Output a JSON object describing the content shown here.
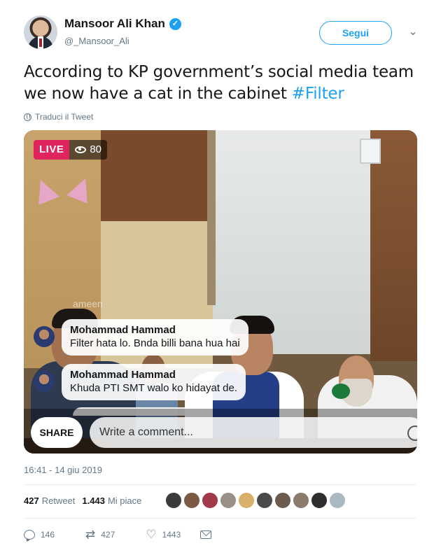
{
  "author": {
    "name": "Mansoor Ali Khan",
    "handle": "@_Mansoor_Ali",
    "verified_glyph": "✓",
    "avatar_icon": "profile-photo"
  },
  "header": {
    "follow_label": "Segui",
    "more_glyph": "⌄"
  },
  "tweet": {
    "text": "According to KP government’s social media team we now have a cat in the cabinet ",
    "hashtag": "#Filter",
    "translate_label": "Traduci il Tweet",
    "timestamp": "16:41 - 14 giu 2019"
  },
  "video": {
    "live_label": "LIVE",
    "viewer_count": "80",
    "faded_comment": "ameen",
    "comments": [
      {
        "name": "Mohammad Hammad",
        "text": "Filter hata lo. Bnda billi bana hua hai"
      },
      {
        "name": "Mohammad Hammad",
        "text": "Khuda PTI SMT walo ko hidayat de."
      }
    ],
    "share_label": "SHARE",
    "comment_placeholder": "Write a comment..."
  },
  "stats": {
    "retweets_count": "427",
    "retweets_label": "Retweet",
    "likes_count": "1.443",
    "likes_label": "Mi piace",
    "liker_colors": [
      "#3b3b3b",
      "#7b5a45",
      "#a23a4a",
      "#9a8f86",
      "#d9b06a",
      "#4a4a4a",
      "#6d5c4e",
      "#8a7b6a",
      "#2e2e2e",
      "#aab8c2"
    ]
  },
  "actions": {
    "replies": "146",
    "retweets": "427",
    "likes": "1443"
  },
  "colors": {
    "accent": "#1da1f2",
    "live": "#e0245e",
    "muted": "#657786"
  }
}
